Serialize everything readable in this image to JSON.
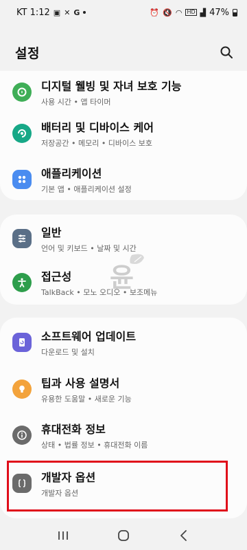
{
  "status_bar": {
    "carrier_time": "KT 1:12",
    "battery": "47%"
  },
  "header": {
    "title": "설정"
  },
  "groups": [
    {
      "items": [
        {
          "title": "디지털 웰빙 및 자녀 보호 기능",
          "subtitle": "사용 시간 • 앱 타이머",
          "icon": "digital-wellbeing-icon",
          "color": "#3fae57"
        },
        {
          "title": "배터리 및 디바이스 케어",
          "subtitle": "저장공간 • 메모리 • 디바이스 보호",
          "icon": "device-care-icon",
          "color": "#17a887"
        },
        {
          "title": "애플리케이션",
          "subtitle": "기본 앱 • 애플리케이션 설정",
          "icon": "apps-icon",
          "color": "#4a8cf0"
        }
      ]
    },
    {
      "items": [
        {
          "title": "일반",
          "subtitle": "언어 및 키보드 • 날짜 및 시간",
          "icon": "general-management-icon",
          "color": "#5a6f87"
        },
        {
          "title": "접근성",
          "subtitle": "TalkBack • 모노 오디오 • 보조메뉴",
          "icon": "accessibility-icon",
          "color": "#2e9e4c"
        }
      ]
    },
    {
      "items": [
        {
          "title": "소프트웨어 업데이트",
          "subtitle": "다운로드 및 설치",
          "icon": "software-update-icon",
          "color": "#6b63d9"
        },
        {
          "title": "팁과 사용 설명서",
          "subtitle": "유용한 도움말 • 새로운 기능",
          "icon": "tips-icon",
          "color": "#f3a33c"
        },
        {
          "title": "휴대전화 정보",
          "subtitle": "상태 • 법률 정보 • 휴대전화 이름",
          "icon": "phone-info-icon",
          "color": "#6b6b6b"
        },
        {
          "title": "개발자 옵션",
          "subtitle": "개발자 옵션",
          "icon": "developer-options-icon",
          "color": "#6b6b6b"
        }
      ]
    }
  ],
  "watermark": "윤",
  "colors": {
    "background": "#f2f2f2",
    "card": "#fcfcfc",
    "highlight": "#e00d1a"
  }
}
